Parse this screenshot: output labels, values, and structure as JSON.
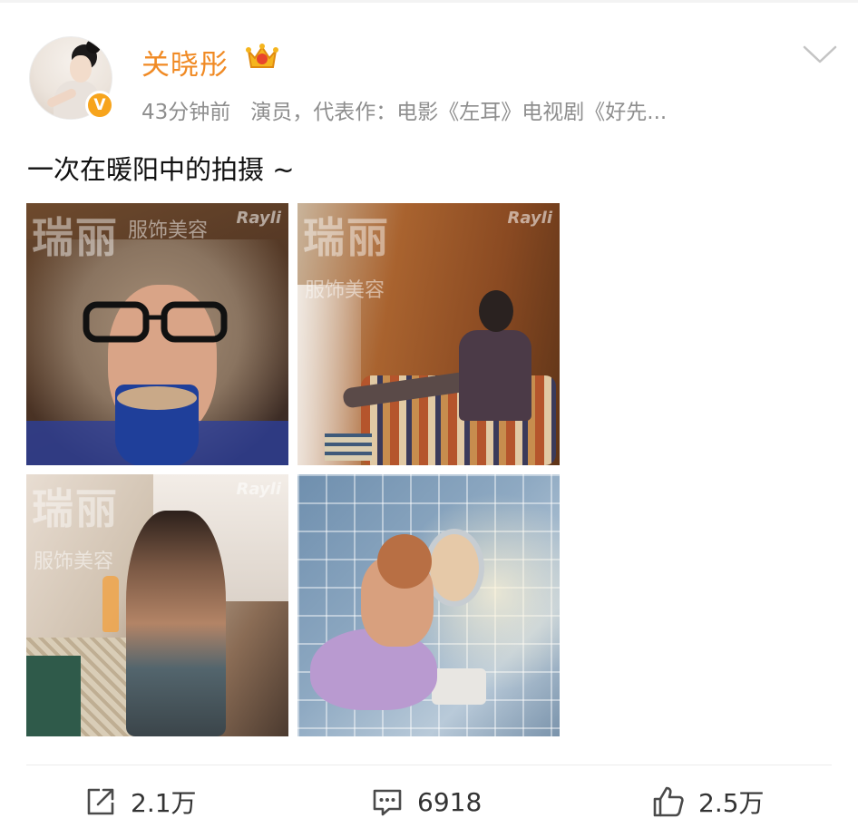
{
  "post": {
    "user": {
      "name": "关晓彤",
      "avatar_icon": "avatar-portrait",
      "verified_badge": "V",
      "vip_icon": "crown-icon",
      "name_color": "#f08a24"
    },
    "time": "43分钟前",
    "description": "演员，代表作：电影《左耳》电视剧《好先...",
    "text": "一次在暖阳中的拍摄 ~",
    "menu_icon": "chevron-down-icon",
    "images": [
      {
        "watermark_big": "瑞丽",
        "watermark_small": "服饰美容",
        "brand": "Rayli"
      },
      {
        "watermark_big": "瑞丽",
        "watermark_small": "服饰美容",
        "brand": "Rayli"
      },
      {
        "watermark_big": "瑞丽",
        "watermark_small": "服饰美容",
        "brand": "Rayli"
      },
      {
        "watermark_big": "",
        "watermark_small": "",
        "brand": ""
      }
    ],
    "actions": {
      "repost": {
        "icon": "repost-icon",
        "count": "2.1万"
      },
      "comment": {
        "icon": "comment-icon",
        "count": "6918"
      },
      "like": {
        "icon": "thumbs-up-icon",
        "count": "2.5万"
      }
    }
  }
}
